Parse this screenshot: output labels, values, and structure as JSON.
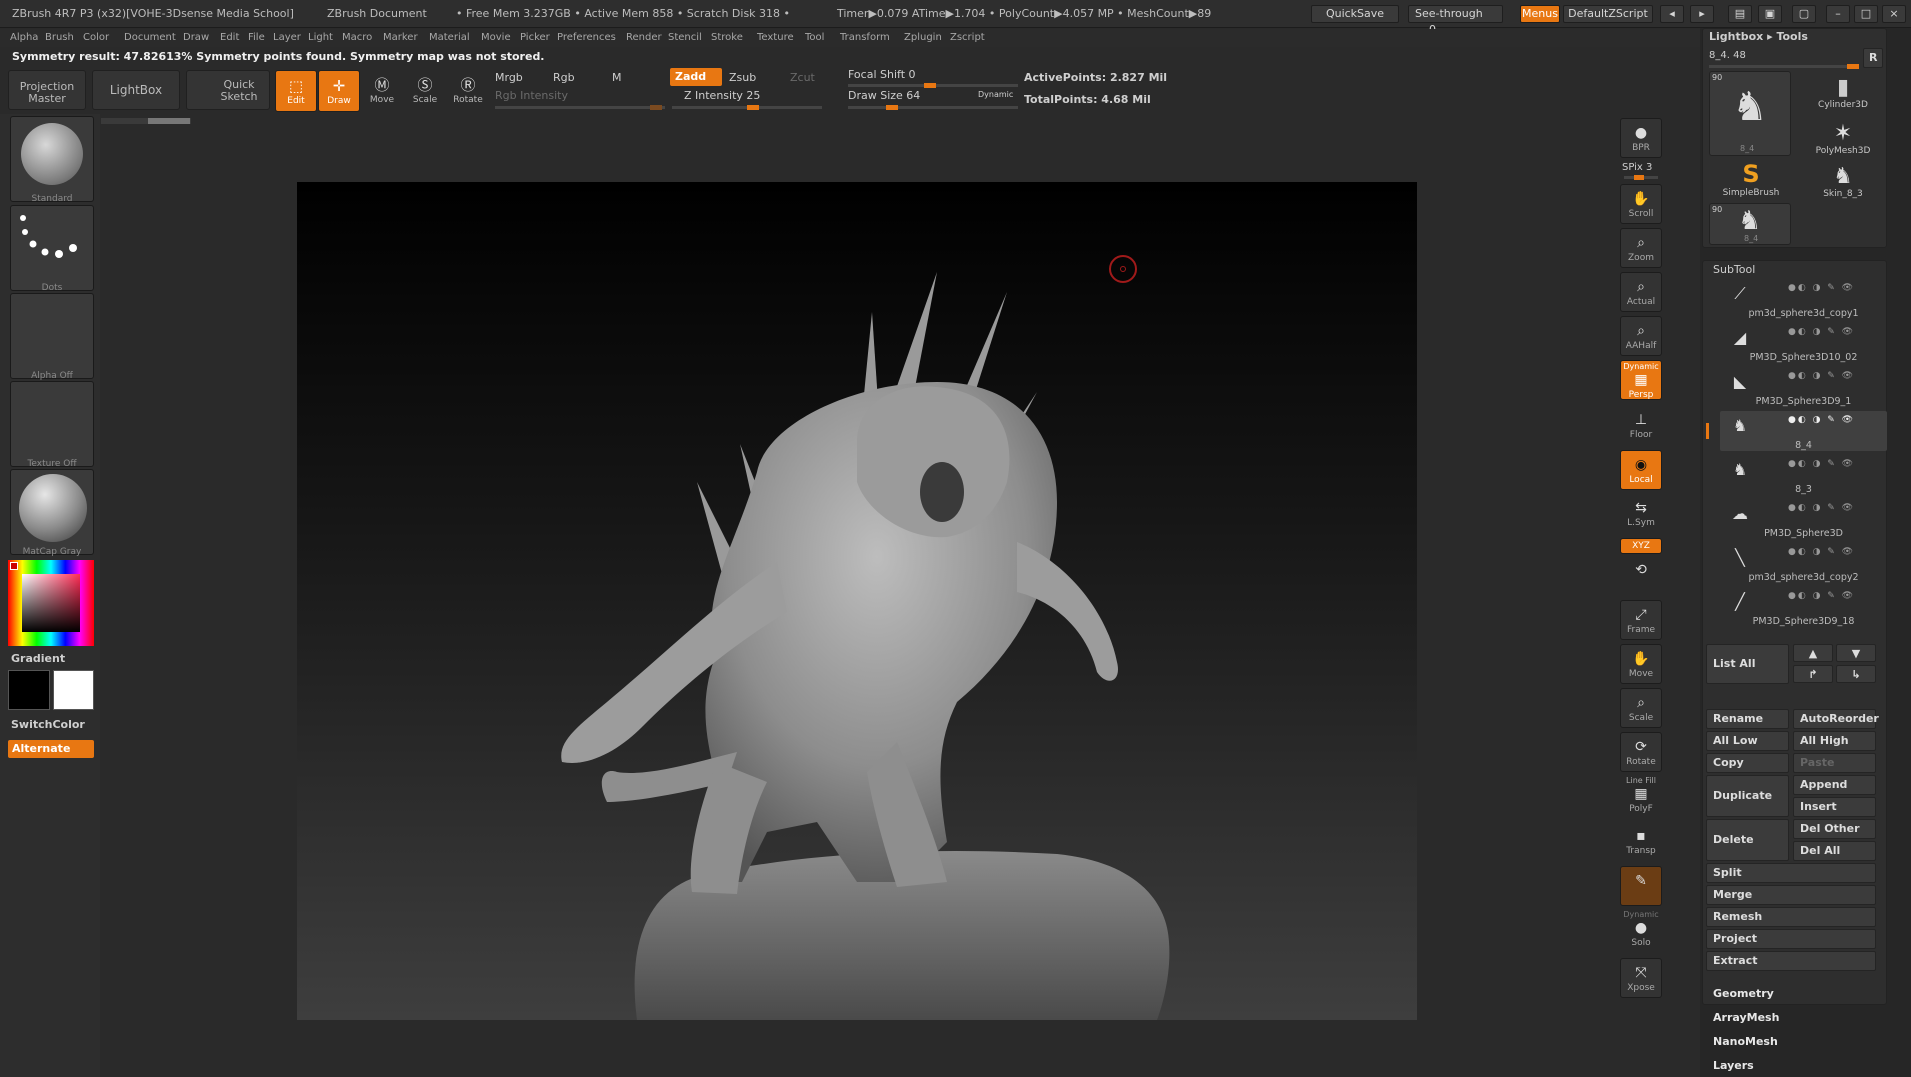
{
  "title_bar": {
    "app_title": "ZBrush 4R7 P3 (x32)[VOHE-3Dsense Media School]",
    "doc_label": "ZBrush Document",
    "mem_info": "• Free Mem 3.237GB • Active Mem 858 • Scratch Disk 318 •",
    "timer_info": "Timer▶0.079 ATime▶1.704 • PolyCount▶4.057 MP • MeshCount▶89",
    "quicksave": "QuickSave",
    "see_through": "See-through",
    "see_through_value": "0",
    "menus": "Menus",
    "default_script": "DefaultZScript"
  },
  "menu": [
    "Alpha",
    "Brush",
    "Color",
    "Document",
    "Draw",
    "Edit",
    "File",
    "Layer",
    "Light",
    "Macro",
    "Marker",
    "Material",
    "Movie",
    "Picker",
    "Preferences",
    "Render",
    "Stencil",
    "Stroke",
    "Texture",
    "Tool",
    "Transform",
    "Zplugin",
    "Zscript"
  ],
  "status": "Symmetry result: 47.82613% Symmetry points found. Symmetry map was not stored.",
  "toolbar": {
    "projection_master": "Projection Master",
    "lightbox": "LightBox",
    "quick_sketch": "Quick Sketch",
    "edit": "Edit",
    "draw": "Draw",
    "move": "Move",
    "scale": "Scale",
    "rotate": "Rotate",
    "mrgb": "Mrgb",
    "rgb": "Rgb",
    "m": "M",
    "rgb_intensity": "Rgb Intensity",
    "zadd": "Zadd",
    "zsub": "Zsub",
    "zcut": "Zcut",
    "z_intensity": "Z Intensity 25",
    "focal_shift": "Focal Shift 0",
    "draw_size": "Draw Size 64",
    "dynamic": "Dynamic",
    "active_points": "ActivePoints: 2.827 Mil",
    "total_points": "TotalPoints: 4.68 Mil"
  },
  "left": {
    "brush": "Standard",
    "stroke": "Dots",
    "alpha": "Alpha Off",
    "texture": "Texture Off",
    "material": "MatCap Gray",
    "gradient": "Gradient",
    "switchcolor": "SwitchColor",
    "alternate": "Alternate"
  },
  "dock": {
    "bpr": "BPR",
    "spix": "SPix 3",
    "scroll": "Scroll",
    "zoom": "Zoom",
    "actual": "Actual",
    "aahalf": "AAHalf",
    "dynamic": "Dynamic",
    "persp": "Persp",
    "floor": "Floor",
    "local": "Local",
    "lsym": "L.Sym",
    "xyz": "XYZ",
    "frame": "Frame",
    "move": "Move",
    "scale": "Scale",
    "rotate": "Rotate",
    "linefill": "Line Fill",
    "polyf": "PolyF",
    "transp": "Transp",
    "dynamic2": "Dynamic",
    "solo": "Solo",
    "xpose": "Xpose"
  },
  "right": {
    "header": "Lightbox ▸ Tools",
    "current_tool": "8_4. 48",
    "r_button": "R",
    "tools": [
      {
        "name": "8_4",
        "badge": "90"
      },
      {
        "name": "Cylinder3D"
      },
      {
        "name": "SimpleBrush"
      },
      {
        "name": "PolyMesh3D"
      },
      {
        "name": "Skin_8_3"
      },
      {
        "name": "8_4",
        "badge": "90"
      }
    ],
    "subtool_header": "SubTool",
    "subtools": [
      "pm3d_sphere3d_copy1",
      "PM3D_Sphere3D10_02",
      "PM3D_Sphere3D9_1",
      "8_4",
      "8_3",
      "PM3D_Sphere3D",
      "pm3d_sphere3d_copy2",
      "PM3D_Sphere3D9_18"
    ],
    "list_all": "List All",
    "buttons": {
      "rename": "Rename",
      "autoreorder": "AutoReorder",
      "all_low": "All Low",
      "all_high": "All High",
      "copy": "Copy",
      "paste": "Paste",
      "duplicate": "Duplicate",
      "append": "Append",
      "insert": "Insert",
      "delete": "Delete",
      "del_other": "Del Other",
      "del_all": "Del All",
      "split": "Split",
      "merge": "Merge",
      "remesh": "Remesh",
      "project": "Project",
      "extract": "Extract"
    },
    "sections": [
      "Geometry",
      "ArrayMesh",
      "NanoMesh",
      "Layers"
    ]
  },
  "colors": {
    "accent": "#e87712",
    "bg": "#2a2a2a",
    "panel": "#262626"
  }
}
